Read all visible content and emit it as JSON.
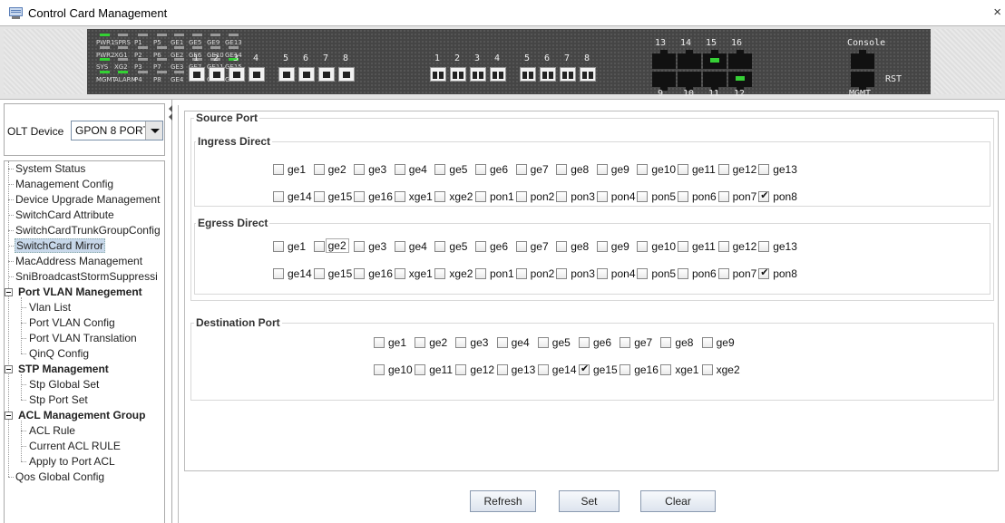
{
  "window": {
    "title": "Control Card Management",
    "close_label": "×"
  },
  "device_panel": {
    "led_labels": [
      [
        "PWR1",
        "SPRS",
        "P1",
        "P5",
        "GE1",
        "GE5",
        "GE9",
        "GE13"
      ],
      [
        "PWR2",
        "XG1",
        "P2",
        "P6",
        "GE2",
        "GE6",
        "GE10",
        "GE14"
      ],
      [
        "SYS",
        "XG2",
        "P3",
        "P7",
        "GE3",
        "GE7",
        "GE11",
        "GE15"
      ],
      [
        "MGMT",
        "ALARM",
        "P4",
        "P8",
        "GE4",
        "GE8",
        "GE12",
        "GE16"
      ]
    ],
    "rj_port_numbers": [
      "1",
      "2",
      "3",
      "4",
      "5",
      "6",
      "7",
      "8"
    ],
    "sfp_port_numbers": [
      "1",
      "2",
      "3",
      "4",
      "5",
      "6",
      "7",
      "8"
    ],
    "uplink_top_numbers": [
      "13",
      "14",
      "15",
      "16"
    ],
    "uplink_bottom_numbers": [
      "9",
      "10",
      "11",
      "12"
    ],
    "console_label": "Console",
    "mgmt_label": "MGMT",
    "rst_label": "RST"
  },
  "olt": {
    "label": "OLT Device",
    "selected": "GPON 8 PORT"
  },
  "nav_tree": [
    {
      "label": "System Status",
      "level": 0
    },
    {
      "label": "Management Config",
      "level": 0
    },
    {
      "label": "Device Upgrade Management",
      "level": 0
    },
    {
      "label": "SwitchCard Attribute",
      "level": 0
    },
    {
      "label": "SwitchCardTrunkGroupConfig",
      "level": 0
    },
    {
      "label": "SwitchCard Mirror",
      "level": 0,
      "selected": true
    },
    {
      "label": "MacAddress Management",
      "level": 0
    },
    {
      "label": "SniBroadcastStormSuppressi",
      "level": 0
    },
    {
      "label": "Port VLAN Manegement",
      "level": 0,
      "group": true
    },
    {
      "label": "Vlan List",
      "level": 1
    },
    {
      "label": "Port VLAN Config",
      "level": 1
    },
    {
      "label": "Port VLAN Translation",
      "level": 1
    },
    {
      "label": "QinQ Config",
      "level": 1
    },
    {
      "label": "STP Management",
      "level": 0,
      "group": true
    },
    {
      "label": "Stp Global Set",
      "level": 1
    },
    {
      "label": "Stp Port Set",
      "level": 1
    },
    {
      "label": "ACL Management Group",
      "level": 0,
      "group": true
    },
    {
      "label": "ACL Rule",
      "level": 1
    },
    {
      "label": "Current ACL RULE",
      "level": 1
    },
    {
      "label": "Apply to Port ACL",
      "level": 1
    },
    {
      "label": "Qos Global Config",
      "level": 0
    }
  ],
  "source_port": {
    "title": "Source Port",
    "ingress": {
      "title": "Ingress Direct",
      "row1": [
        "ge1",
        "ge2",
        "ge3",
        "ge4",
        "ge5",
        "ge6",
        "ge7",
        "ge8",
        "ge9",
        "ge10",
        "ge11",
        "ge12",
        "ge13"
      ],
      "row2": [
        "ge14",
        "ge15",
        "ge16",
        "xge1",
        "xge2",
        "pon1",
        "pon2",
        "pon3",
        "pon4",
        "pon5",
        "pon6",
        "pon7",
        "pon8"
      ],
      "checked": [
        "pon8"
      ]
    },
    "egress": {
      "title": "Egress Direct",
      "row1": [
        "ge1",
        "ge2",
        "ge3",
        "ge4",
        "ge5",
        "ge6",
        "ge7",
        "ge8",
        "ge9",
        "ge10",
        "ge11",
        "ge12",
        "ge13"
      ],
      "row2": [
        "ge14",
        "ge15",
        "ge16",
        "xge1",
        "xge2",
        "pon1",
        "pon2",
        "pon3",
        "pon4",
        "pon5",
        "pon6",
        "pon7",
        "pon8"
      ],
      "checked": [
        "pon8"
      ],
      "focused": "ge2"
    }
  },
  "destination_port": {
    "title": "Destination Port",
    "row1": [
      "ge1",
      "ge2",
      "ge3",
      "ge4",
      "ge5",
      "ge6",
      "ge7",
      "ge8",
      "ge9"
    ],
    "row2": [
      "ge10",
      "ge11",
      "ge12",
      "ge13",
      "ge14",
      "ge15",
      "ge16",
      "xge1",
      "xge2"
    ],
    "checked": [
      "ge15"
    ]
  },
  "buttons": {
    "refresh": "Refresh",
    "set": "Set",
    "clear": "Clear"
  }
}
